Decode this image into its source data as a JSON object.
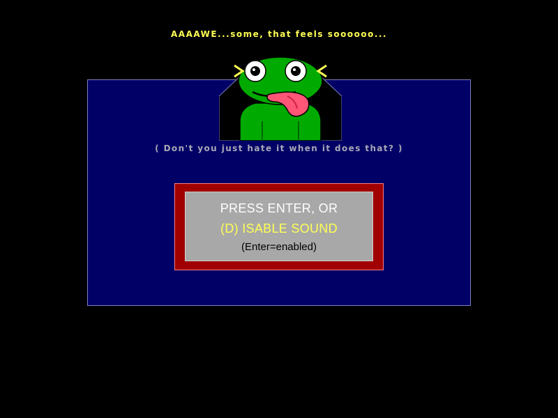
{
  "caption": {
    "top": "AAAAWE...some, that feels soooooo...",
    "sub": "( Don't you just hate it when it does that? )"
  },
  "dialog": {
    "line1": "PRESS  ENTER, OR",
    "line2": "(D) ISABLE SOUND",
    "line3": "(Enter=enabled)"
  },
  "icons": {
    "character": "frog-icon"
  },
  "colors": {
    "background": "#000000",
    "panel": "#000066",
    "panel_border": "#8080c0",
    "caption_top": "#ffff55",
    "caption_sub": "#a8a8b8",
    "dialog_border": "#a00000",
    "dialog_face": "#a8a8a8",
    "dialog_text": "#ffffff",
    "dialog_highlight": "#ffff55",
    "frog_green": "#00aa00",
    "tongue": "#ff5577"
  }
}
